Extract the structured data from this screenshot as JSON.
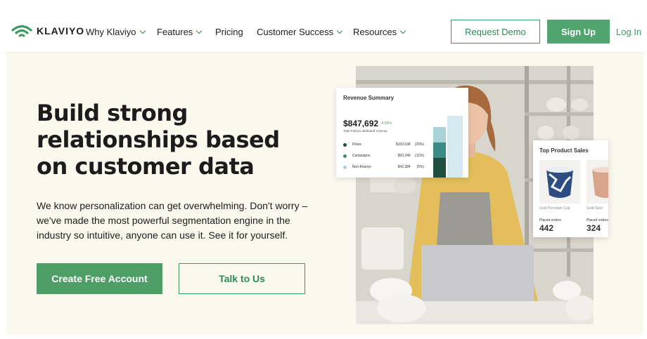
{
  "brand": {
    "name": "KLAVIYO",
    "color": "#3d9a62"
  },
  "nav": {
    "items": [
      {
        "label": "Why Klaviyo",
        "dropdown": true
      },
      {
        "label": "Features",
        "dropdown": true
      },
      {
        "label": "Pricing",
        "dropdown": false
      },
      {
        "label": "Customer Success",
        "dropdown": true
      },
      {
        "label": "Resources",
        "dropdown": true
      }
    ],
    "request_demo": "Request Demo",
    "sign_up": "Sign Up",
    "log_in": "Log In"
  },
  "hero": {
    "title": "Build strong relationships based on customer data",
    "subtitle": "We know personalization can get overwhelming. Don't worry – we've made the most powerful segmentation engine in the industry so intuitive, anyone can use it. See it for yourself.",
    "primary_cta": "Create Free Account",
    "secondary_cta": "Talk to Us"
  },
  "revenue_card": {
    "title": "Revenue Summary",
    "amount": "$847,692",
    "delta": "-6.53%",
    "caption": "Total Klaviyo attributed revenue",
    "rows": [
      {
        "label": "Flows",
        "value": "$169,538",
        "pct": "(20%)",
        "color": "#1f4d40"
      },
      {
        "label": "Campaigns",
        "value": "$93,246",
        "pct": "(11%)",
        "color": "#3a8a86"
      },
      {
        "label": "Non-Klaviyo",
        "value": "$42,384",
        "pct": "(5%)",
        "color": "#a8d3d8"
      }
    ]
  },
  "product_card": {
    "title": "Top Product Sales",
    "products": [
      {
        "name": "Gold Porcelain Cup",
        "placed_label": "Placed orders",
        "count": "442"
      },
      {
        "name": "Gold Swirl",
        "placed_label": "Placed orders",
        "count": "324"
      }
    ]
  },
  "colors": {
    "accent": "#4f9e68",
    "hero_bg": "#fbf9ee"
  }
}
